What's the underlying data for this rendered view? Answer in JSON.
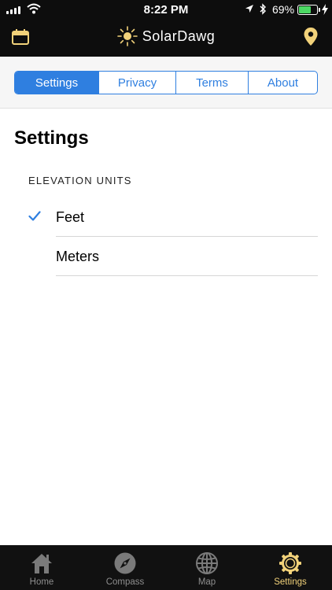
{
  "status_bar": {
    "time": "8:22 PM",
    "battery_percent": "69%",
    "battery_level": 0.69
  },
  "navbar": {
    "app_name": "SolarDawg",
    "left_icon": "calendar-icon",
    "right_icon": "location-pin-icon"
  },
  "segments": [
    {
      "label": "Settings",
      "selected": true
    },
    {
      "label": "Privacy",
      "selected": false
    },
    {
      "label": "Terms",
      "selected": false
    },
    {
      "label": "About",
      "selected": false
    }
  ],
  "page": {
    "title": "Settings",
    "section_header": "ELEVATION UNITS",
    "options": [
      {
        "label": "Feet",
        "checked": true
      },
      {
        "label": "Meters",
        "checked": false
      }
    ]
  },
  "tabbar": {
    "items": [
      {
        "label": "Home",
        "icon": "home-icon",
        "active": false
      },
      {
        "label": "Compass",
        "icon": "compass-icon",
        "active": false
      },
      {
        "label": "Map",
        "icon": "globe-icon",
        "active": false
      },
      {
        "label": "Settings",
        "icon": "gear-icon",
        "active": true
      }
    ]
  },
  "colors": {
    "accent": "#2f7fe0",
    "brand_yellow": "#f2d27a",
    "bar_background": "#0d0d0d"
  }
}
